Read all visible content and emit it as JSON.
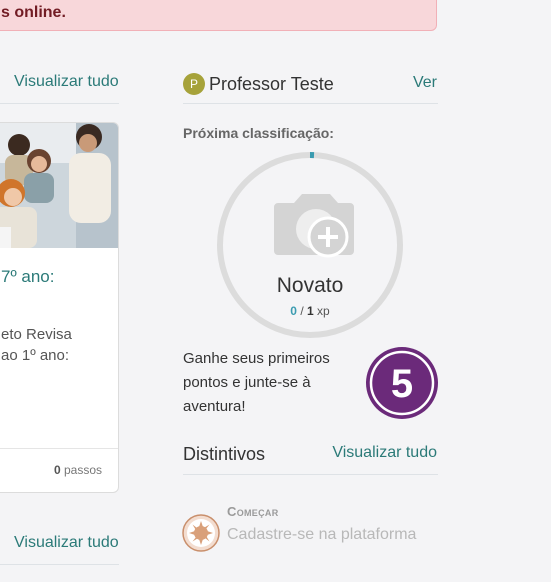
{
  "alert": {
    "text": "s online."
  },
  "left": {
    "view_all_top": "Visualizar tudo",
    "card": {
      "title": "7º ano:",
      "desc_line1": "eto Revisa",
      "desc_line2": "ao 1º ano:",
      "steps_count": "0",
      "steps_label": "passos"
    },
    "view_all_bottom": "Visualizar tudo"
  },
  "profile": {
    "badge_letter": "P",
    "name": "Professor Teste",
    "view_link": "Ver",
    "next_rank_label": "Próxima classificação:",
    "rank": {
      "name": "Novato",
      "xp_current": "0",
      "xp_separator": " / ",
      "xp_total": "1",
      "xp_unit": " xp",
      "progress": 0
    },
    "cta": "Ganhe seus primeiros pontos e junte-se à aventura!",
    "reward_number": "5"
  },
  "badges": {
    "title": "Distintivos",
    "view_all": "Visualizar tudo",
    "item": {
      "title": "Começar",
      "desc": "Cadastre-se na plataforma",
      "icon": "sun-badge-icon"
    }
  },
  "colors": {
    "link": "#2b7a78",
    "alert_bg": "#f8d7da",
    "reward_purple": "#6b2a7a",
    "profile_badge": "#a6a23a",
    "ring_progress": "#3a9bb0"
  }
}
